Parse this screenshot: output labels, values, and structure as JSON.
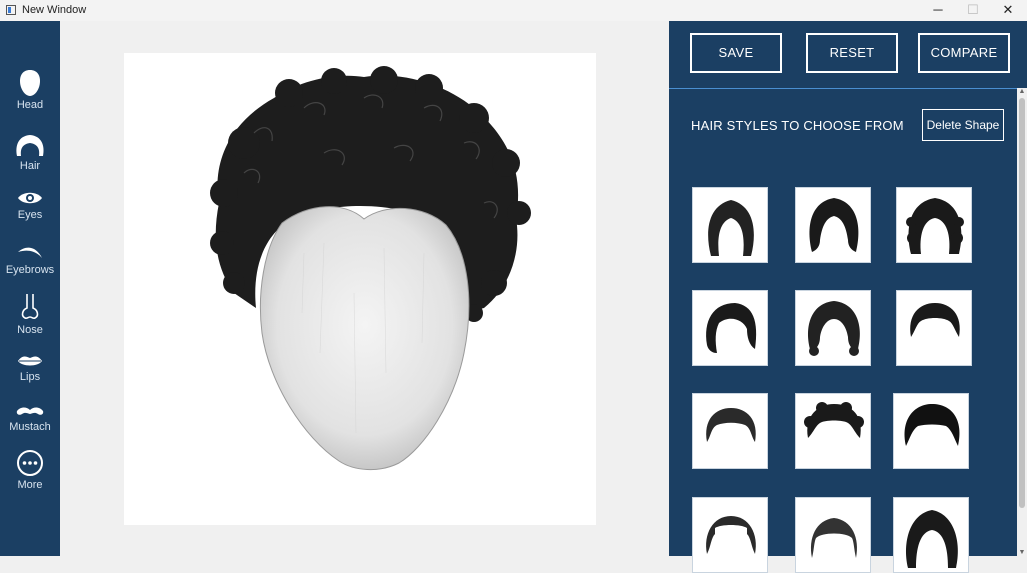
{
  "window": {
    "title": "New Window",
    "minimize": "─",
    "maximize": "☐",
    "close": "✕"
  },
  "sidebar": {
    "items": [
      {
        "label": "Head",
        "icon": "head-icon"
      },
      {
        "label": "Hair",
        "icon": "hair-icon"
      },
      {
        "label": "Eyes",
        "icon": "eye-icon"
      },
      {
        "label": "Eyebrows",
        "icon": "eyebrow-icon"
      },
      {
        "label": "Nose",
        "icon": "nose-icon"
      },
      {
        "label": "Lips",
        "icon": "lips-icon"
      },
      {
        "label": "Mustach",
        "icon": "mustache-icon"
      },
      {
        "label": "More",
        "icon": "more-icon"
      }
    ]
  },
  "toolbar": {
    "save_label": "SAVE",
    "reset_label": "RESET",
    "compare_label": "COMPARE"
  },
  "styles_panel": {
    "title": "HAIR STYLES TO CHOOSE FROM",
    "delete_label": "Delete Shape",
    "thumbnails": [
      "long-straight-hair",
      "long-bob-hair",
      "long-curly-hair",
      "side-bob-hair",
      "wavy-bob-hair",
      "short-hair",
      "short-hair",
      "short-curly-hair",
      "short-textured-hair",
      "receding-hair",
      "bald-top-hair",
      "shoulder-length-hair"
    ]
  },
  "colors": {
    "sidebar_bg": "#1b3f63",
    "panel_bg": "#1b3f63",
    "accent_line": "#4a8fd1"
  }
}
